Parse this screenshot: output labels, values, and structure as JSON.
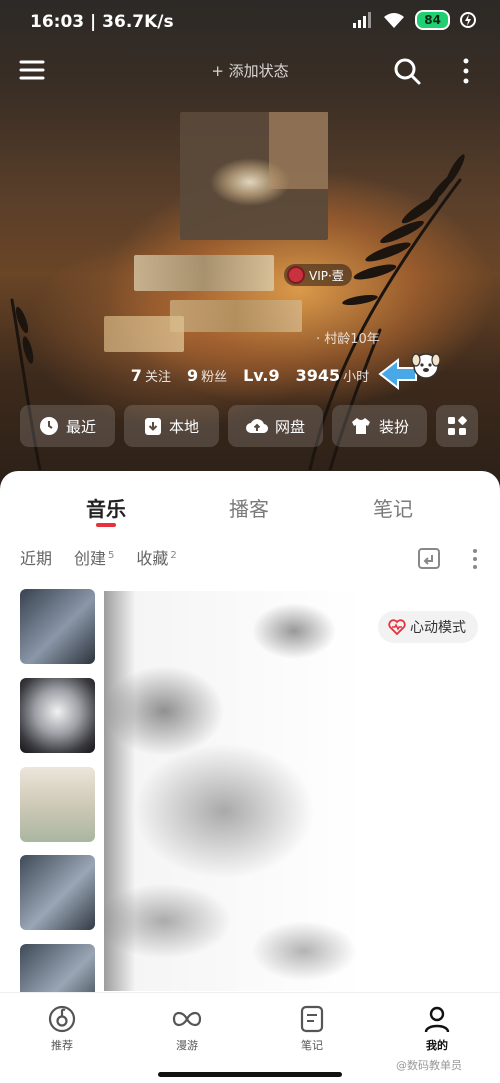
{
  "status_bar": {
    "time": "16:03 | 36.7K/s",
    "battery": "84"
  },
  "header": {
    "add_status": "+ 添加状态"
  },
  "profile": {
    "vip_label": "VIP·壹",
    "age_label": "· 村龄10年",
    "stats": [
      {
        "num": "7",
        "label": "关注"
      },
      {
        "num": "9",
        "label": "粉丝"
      },
      {
        "num": "Lv.9",
        "label": ""
      },
      {
        "num": "3945",
        "label": "小时"
      }
    ]
  },
  "quick_actions": [
    {
      "label": "最近",
      "icon": "clock-icon"
    },
    {
      "label": "本地",
      "icon": "download-icon"
    },
    {
      "label": "网盘",
      "icon": "cloud-icon"
    },
    {
      "label": "装扮",
      "icon": "shirt-icon"
    }
  ],
  "content_tabs": [
    "音乐",
    "播客",
    "笔记"
  ],
  "sub_tabs": [
    {
      "label": "近期",
      "count": ""
    },
    {
      "label": "创建",
      "count": "5"
    },
    {
      "label": "收藏",
      "count": "2"
    }
  ],
  "heart_mode_label": "心动模式",
  "bottom_nav": [
    {
      "label": "推荐",
      "icon": "netease-icon"
    },
    {
      "label": "漫游",
      "icon": "infinity-icon"
    },
    {
      "label": "笔记",
      "icon": "note-icon"
    },
    {
      "label": "我的",
      "icon": "user-icon"
    }
  ],
  "watermark": "@数码教单员",
  "colors": {
    "accent": "#e8313e",
    "battery": "#1fcf72",
    "arrow": "#49a9e6"
  }
}
